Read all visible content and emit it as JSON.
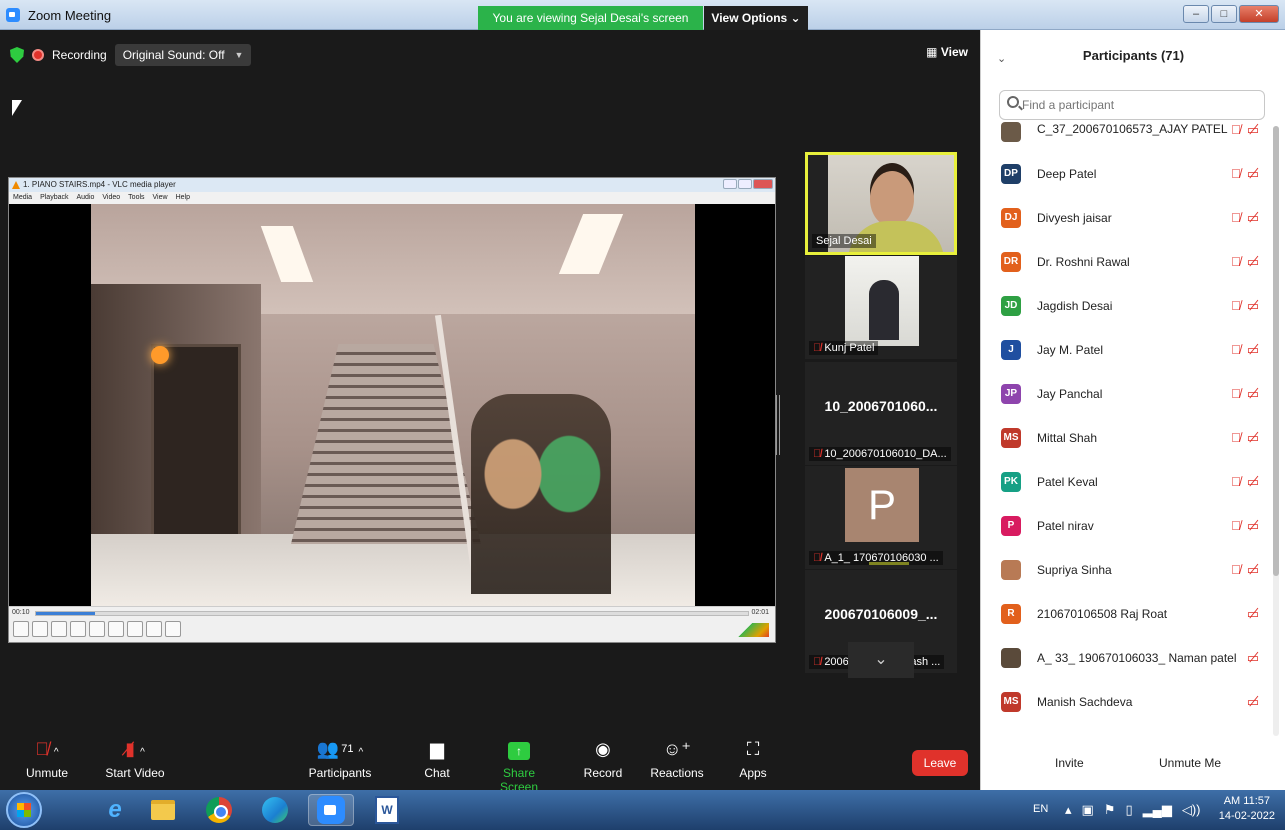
{
  "window": {
    "title": "Zoom Meeting",
    "viewing_banner": "You are viewing Sejal Desai's screen",
    "view_options": "View Options ⌄",
    "min": "–",
    "max": "□",
    "close": "✕"
  },
  "meeting_top": {
    "recording": "Recording",
    "original_sound": "Original Sound: Off",
    "view": "View"
  },
  "shared_screen": {
    "vlc_title": "1. PIANO STAIRS.mp4 - VLC media player",
    "vlc_menu": [
      "Media",
      "Playback",
      "Audio",
      "Video",
      "Tools",
      "View",
      "Help"
    ],
    "time_elapsed": "00:10",
    "time_total": "02:01",
    "progress": 0.083
  },
  "video_strip": [
    {
      "name": "Sejal Desai",
      "active": true
    },
    {
      "name": "Kunj Patel"
    },
    {
      "name": "10_200670106010_DA...",
      "center_text": "10_2006701060..."
    },
    {
      "name": "A_1_ 170670106030 ...",
      "avatar_letter": "P"
    },
    {
      "name": "200670106009_Yash ...",
      "center_text": "200670106009_..."
    }
  ],
  "toolbar": {
    "unmute": "Unmute",
    "start_video": "Start Video",
    "participants": "Participants",
    "participants_count": "71",
    "chat": "Chat",
    "share_screen": "Share Screen",
    "record": "Record",
    "reactions": "Reactions",
    "apps": "Apps",
    "leave": "Leave"
  },
  "panel": {
    "title": "Participants (71)",
    "search_placeholder": "Find a participant",
    "invite": "Invite",
    "unmute_me": "Unmute Me",
    "participants": [
      {
        "initials": "",
        "name": "C_37_200670106573_AJAY PATEL",
        "color": "#6b5a48",
        "mic_off": true
      },
      {
        "initials": "DP",
        "name": "Deep Patel",
        "color": "#1f3f68",
        "mic_off": true
      },
      {
        "initials": "DJ",
        "name": "Divyesh jaisar",
        "color": "#e2601c",
        "mic_off": true
      },
      {
        "initials": "DR",
        "name": "Dr. Roshni Rawal",
        "color": "#e2601c",
        "mic_off": true
      },
      {
        "initials": "JD",
        "name": "Jagdish Desai",
        "color": "#2ea043",
        "mic_off": true
      },
      {
        "initials": "J",
        "name": "Jay M. Patel",
        "color": "#1f4fa0",
        "mic_off": true
      },
      {
        "initials": "JP",
        "name": "Jay Panchal",
        "color": "#8e44ad",
        "mic_off": true
      },
      {
        "initials": "MS",
        "name": "Mittal Shah",
        "color": "#c0392b",
        "mic_off": true
      },
      {
        "initials": "PK",
        "name": "Patel Keval",
        "color": "#16a085",
        "mic_off": true
      },
      {
        "initials": "P",
        "name": "Patel nirav",
        "color": "#d81b60",
        "mic_off": true
      },
      {
        "initials": "",
        "name": "Supriya Sinha",
        "color": "#b87a55",
        "mic_off": true
      },
      {
        "initials": "R",
        "name": "210670106508 Raj Roat",
        "color": "#e2601c",
        "mic_off": false
      },
      {
        "initials": "",
        "name": "A_ 33_ 190670106033_ Naman patel",
        "color": "#5a4a3a",
        "mic_off": false
      },
      {
        "initials": "MS",
        "name": "Manish Sachdeva",
        "color": "#c0392b",
        "mic_off": false
      }
    ]
  },
  "taskbar": {
    "lang": "EN",
    "time": "AM 11:57",
    "date": "14-02-2022",
    "word_label": "W"
  }
}
